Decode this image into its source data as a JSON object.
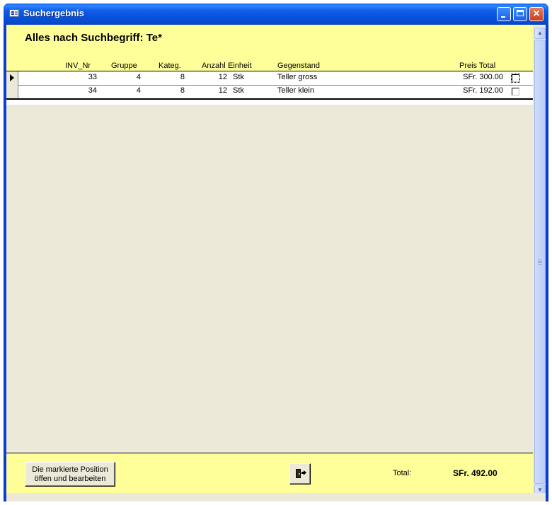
{
  "window": {
    "title": "Suchergebnis"
  },
  "header": {
    "heading": "Alles nach Suchbegriff: Te*"
  },
  "columns": {
    "inv_nr": "INV_Nr",
    "gruppe": "Gruppe",
    "kateg": "Kateg.",
    "anzahl": "Anzahl",
    "einheit": "Einheit",
    "gegenstand": "Gegenstand",
    "preis_total": "Preis Total"
  },
  "rows": [
    {
      "inv_nr": "33",
      "gruppe": "4",
      "kateg": "8",
      "anzahl": "12",
      "einheit": "Stk",
      "gegenstand": "Teller gross",
      "preis": "SFr. 300.00",
      "checked": false,
      "selected": true
    },
    {
      "inv_nr": "34",
      "gruppe": "4",
      "kateg": "8",
      "anzahl": "12",
      "einheit": "Stk",
      "gegenstand": "Teller klein",
      "preis": "SFr. 192.00",
      "checked": false,
      "selected": false
    }
  ],
  "footer": {
    "edit_button_line1": "Die markierte Position",
    "edit_button_line2": "öffen und bearbeiten",
    "exit_icon": "exit-door-icon",
    "total_label": "Total:",
    "total_value": "SFr. 492.00"
  },
  "colors": {
    "band": "#ffff99",
    "titlebar": "#0a5ff0",
    "client": "#ece9d8"
  }
}
